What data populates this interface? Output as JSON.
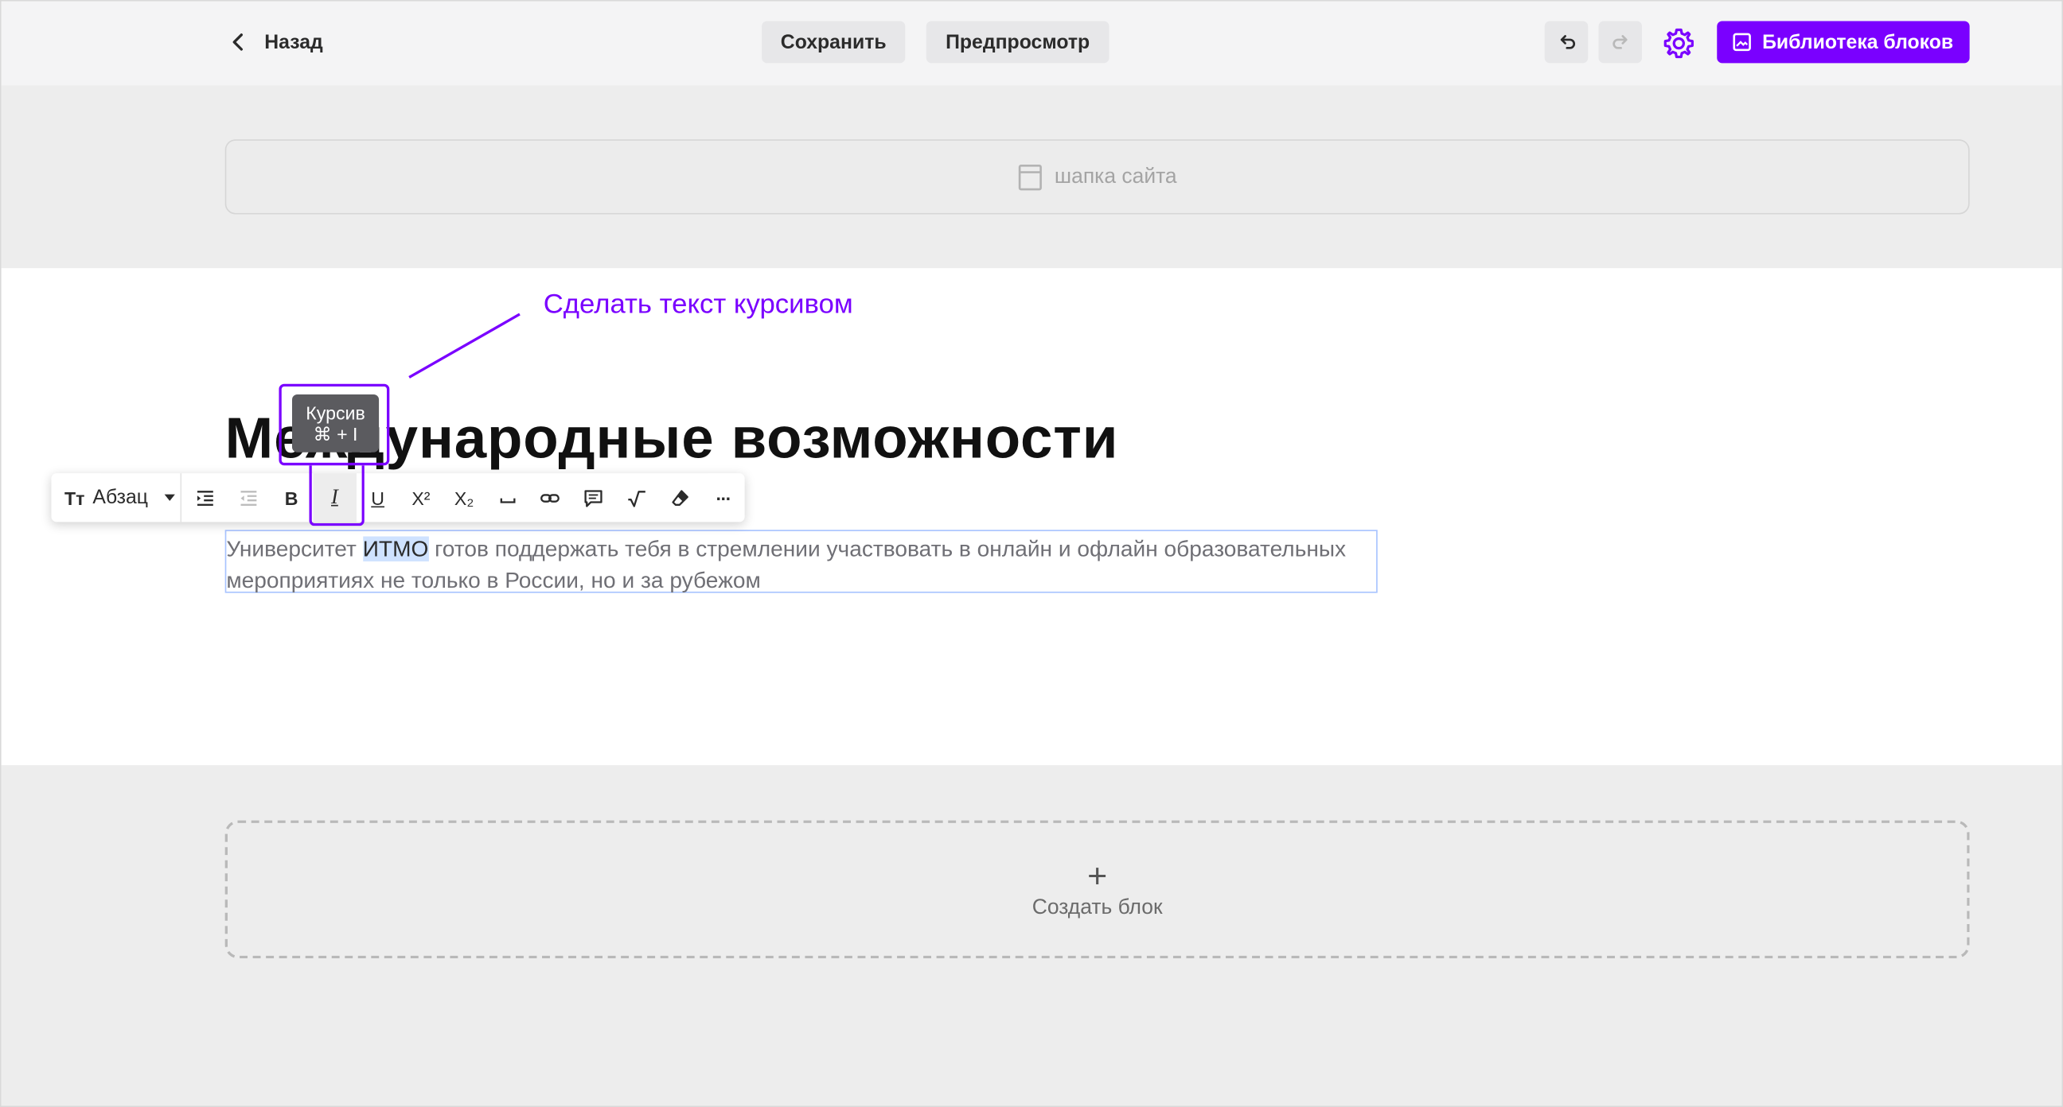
{
  "topbar": {
    "back_label": "Назад",
    "save_label": "Сохранить",
    "preview_label": "Предпросмотр",
    "library_label": "Библиотека блоков",
    "accent_color": "#7a00ff"
  },
  "header_zone": {
    "placeholder": "шапка сайта",
    "icon": "page-icon"
  },
  "content": {
    "annotation": "Сделать текст курсивом",
    "title": "Международные возможности",
    "paragraph_before": "Университет ",
    "paragraph_selected": "ИТМО",
    "paragraph_after": " готов поддержать тебя в стремлении участвовать в онлайн и офлайн образовательных мероприятиях не только в России, но и за рубежом"
  },
  "tooltip": {
    "label": "Курсив",
    "shortcut": "⌘ + I"
  },
  "toolbar": {
    "style_icon_label": "Tт",
    "style_label": "Абзац",
    "bold_label": "B",
    "italic_label": "I",
    "underline_label": "U",
    "superscript_label": "X²",
    "subscript_label": "X₂",
    "more_label": "···",
    "icons": [
      "indent-icon",
      "outdent-icon",
      "bold-icon",
      "italic-icon",
      "underline-icon",
      "superscript-icon",
      "subscript-icon",
      "nbsp-icon",
      "link-icon",
      "comment-icon",
      "formula-icon",
      "eraser-icon",
      "more-icon"
    ]
  },
  "lower_zone": {
    "create_label": "Создать блок",
    "plus_label": "+"
  }
}
